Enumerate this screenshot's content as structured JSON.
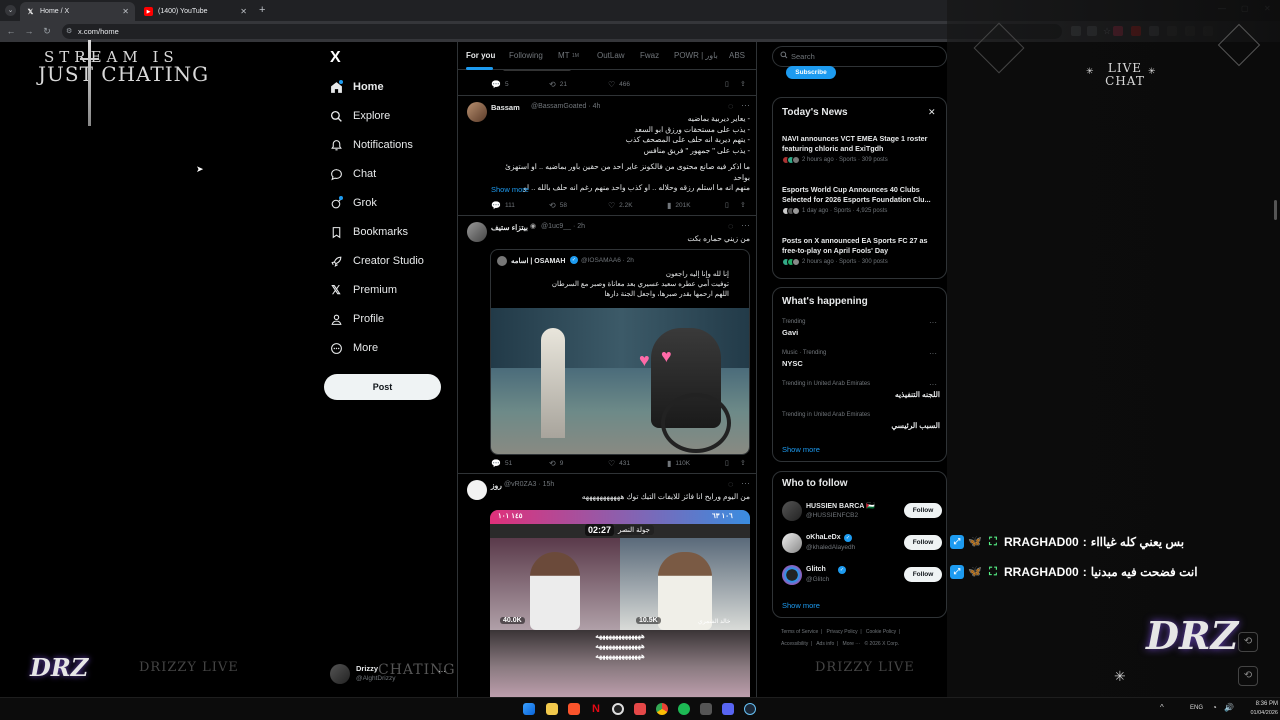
{
  "browser": {
    "tabs": [
      {
        "title": "Home / X",
        "icon": "x-logo-icon"
      },
      {
        "title": "(1400) YouTube",
        "icon": "youtube-icon"
      }
    ],
    "url": "x.com/home"
  },
  "overlay": {
    "stream_title_1": "STREAM IS",
    "stream_title_2": "JUST CHATING",
    "live_chat": "LIVE CHAT",
    "brand_left": "DRZ",
    "drizzy_live_left": "DRIZZY LIVE",
    "drizzy_live_right": "DRIZZY LIVE",
    "chating_watermark": "CHATING",
    "brand_right": "DRZ",
    "chat_messages": [
      {
        "user": "RRAGHAD00",
        "text": "بس يعني كله غياااء"
      },
      {
        "user": "RRAGHAD00",
        "text": "انت فضحت فيه مبدنيا"
      }
    ]
  },
  "nav": {
    "logo": "X",
    "items": [
      {
        "label": "Home",
        "icon": "home-icon"
      },
      {
        "label": "Explore",
        "icon": "search-icon"
      },
      {
        "label": "Notifications",
        "icon": "bell-icon"
      },
      {
        "label": "Chat",
        "icon": "chat-bubble-icon"
      },
      {
        "label": "Grok",
        "icon": "grok-icon"
      },
      {
        "label": "Bookmarks",
        "icon": "bookmark-icon"
      },
      {
        "label": "Creator Studio",
        "icon": "rocket-icon"
      },
      {
        "label": "Premium",
        "icon": "x-logo-icon"
      },
      {
        "label": "Profile",
        "icon": "person-icon"
      },
      {
        "label": "More",
        "icon": "more-circle-icon"
      }
    ],
    "post_button": "Post",
    "account": {
      "name": "Drizzy",
      "handle": "@AlghtDrizzy"
    }
  },
  "feed": {
    "tabs": [
      "For you",
      "Following",
      "MT",
      "OutLaw",
      "Fwaz",
      "POWR | باور",
      "ABS"
    ],
    "tab_badge": "1M",
    "tweet0": {
      "replies": "5",
      "reposts": "21",
      "likes": "466",
      "views": ""
    },
    "tweet1": {
      "name": "Bassam",
      "handle": "@BassamGoated · 4h",
      "lines": [
        "- يعاير ديربية بماضيه",
        "- يذب على مستحقات ورزق ابو السعد",
        "- يتهم ديربة انه حلف على المصحف كذب",
        "- يذب على \" جمهور \" فريق منافس",
        "",
        "ما اذكر فيه صانع محتوى من فالكونز عاير احد من حقين باور بماضيه .. او استهزئ بواحد",
        "منهم انه ما استلم رزقه وحلاله .. او كذب واحد منهم رغم انه حلف بالله .. او"
      ],
      "show_more": "Show more",
      "replies": "111",
      "reposts": "58",
      "likes": "2.2K",
      "views": "201K"
    },
    "tweet2": {
      "name": "بيتزاء ستيف",
      "handle": "@1uc9__ · 2h",
      "text": "من زيني حماره بكت",
      "quote": {
        "name": "اسامه | OSAMAH",
        "handle": "@IOSAMAA6 · 2h",
        "lines": [
          "إنا لله وإنا إليه راجعون",
          "توفيت أمي عطره سعيد عسيري بعد معاناة وصبر مع السرطان",
          "اللهم ارحمها بقدر صبرها، واجعل الجنة دارها"
        ]
      },
      "replies": "51",
      "reposts": "9",
      "likes": "431",
      "views": "110K"
    },
    "tweet3": {
      "name": "روز",
      "handle": "@vR0ZA3 · 15h",
      "text": "من اليوم ورايح انا فائز للايفات التيك توك هههههههههههه",
      "video": {
        "timer": "02:27",
        "banner": "جولة النصر",
        "left_score": "١٤٥ ١٠١",
        "right_score": "١٠٦ ٦٣",
        "left_count": "40.0K",
        "right_count": "10.5K",
        "right_name": "خالد الشمري",
        "overlay_text": "ههههههههههههههه"
      }
    }
  },
  "right": {
    "search_placeholder": "Search",
    "subscribe": "Subscribe",
    "news_title": "Today's News",
    "news": [
      {
        "headline": "NAVI announces VCT EMEA Stage 1 roster featuring chloric and ExiTgdh",
        "meta": "2 hours ago · Sports · 309 posts"
      },
      {
        "headline": "Esports World Cup Announces 40 Clubs Selected for 2026 Esports Foundation Clu...",
        "meta": "1 day ago · Sports · 4,925 posts"
      },
      {
        "headline": "Posts on X announced EA Sports FC 27 as free-to-play on April Fools' Day",
        "meta": "2 hours ago · Sports · 300 posts"
      }
    ],
    "happening_title": "What's happening",
    "trends": [
      {
        "context": "Trending",
        "title": "Gavi"
      },
      {
        "context": "Music · Trending",
        "title": "NYSC"
      },
      {
        "context": "Trending in United Arab Emirates",
        "title": "اللجنه التنفيذيه"
      },
      {
        "context": "Trending in United Arab Emirates",
        "title": "السبب الرئيسي"
      }
    ],
    "show_more": "Show more",
    "follow_title": "Who to follow",
    "follow": [
      {
        "name": "HUSSIEN BARCA 🇵🇸",
        "handle": "@HUSSIENFCB2",
        "button": "Follow"
      },
      {
        "name": "oKhaLeDx",
        "handle": "@khaledAlayedh",
        "button": "Follow"
      },
      {
        "name": "Glitch",
        "handle": "@Glitch",
        "button": "Follow"
      }
    ],
    "footer_row1": [
      "Terms of Service",
      "Privacy Policy",
      "Cookie Policy"
    ],
    "footer_row2": [
      "Accessibility",
      "Ads info",
      "More ···",
      "© 2026 X Corp."
    ]
  },
  "taskbar": {
    "lang": "ENG",
    "time": "8:36 PM",
    "date": "01/04/2026"
  },
  "colors": {
    "accent": "#1d9bf0",
    "bg": "#000000",
    "border": "#2f3336",
    "muted": "#71767b"
  }
}
